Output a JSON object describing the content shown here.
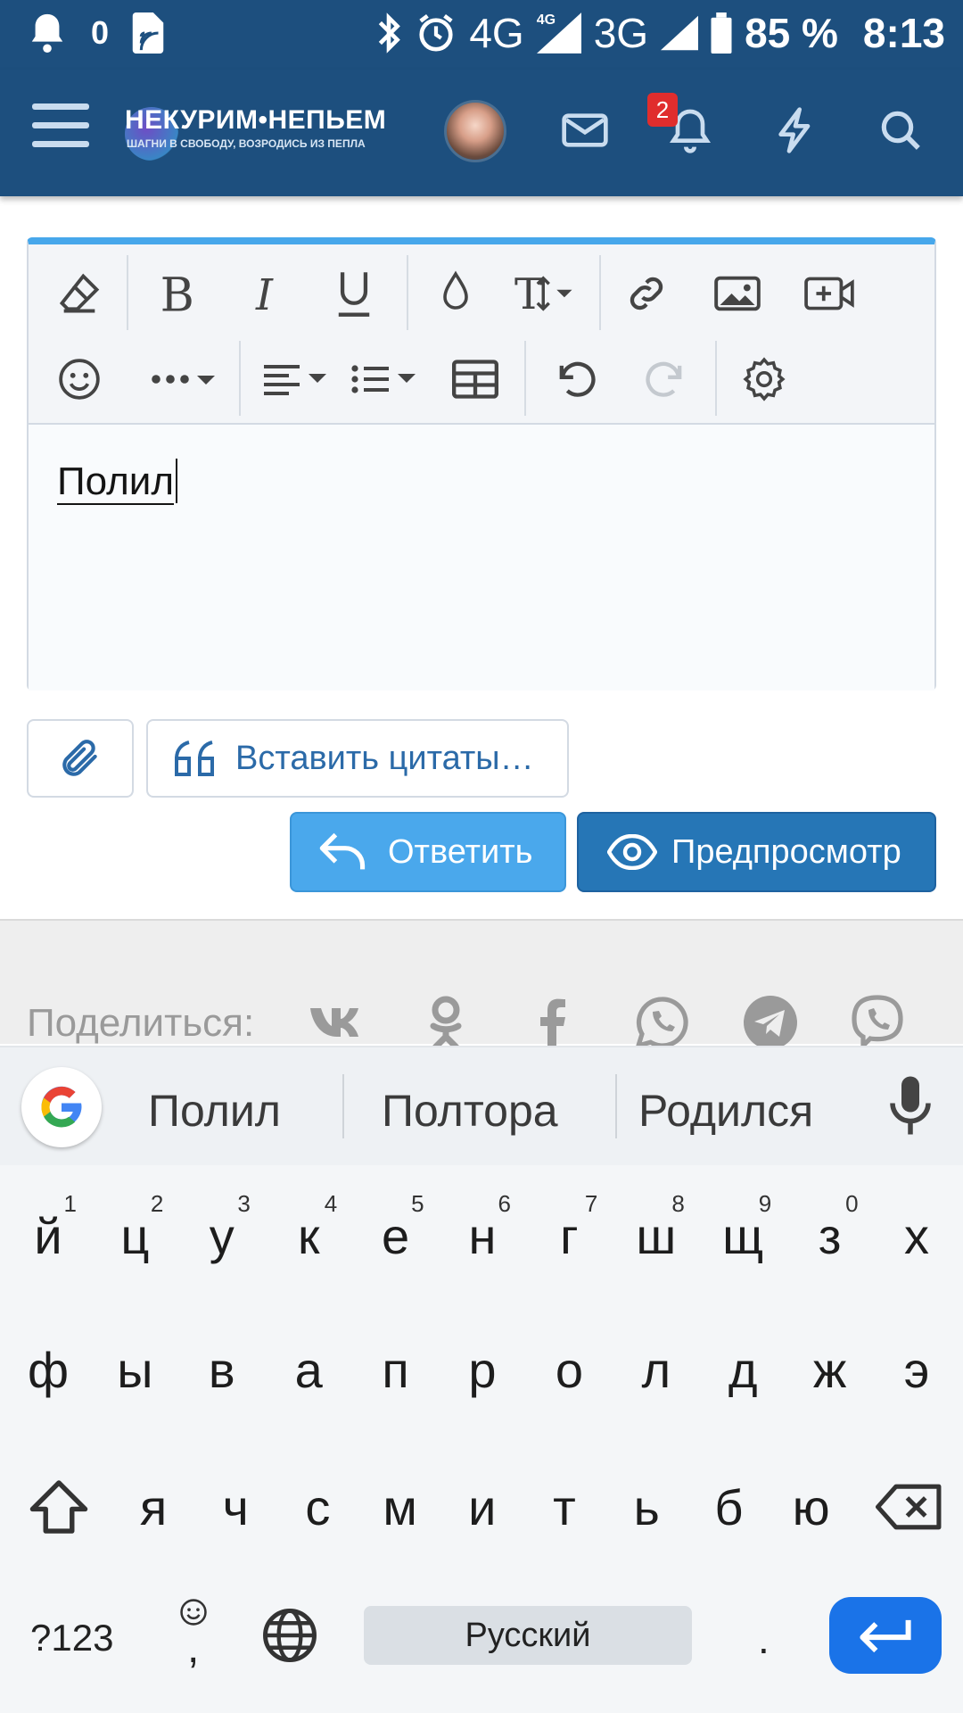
{
  "status": {
    "notif_count": "0",
    "network1": "4G",
    "network1_small": "4G",
    "network2": "3G",
    "battery": "85 %",
    "time": "8:13"
  },
  "header": {
    "logo_main": "НЕКУРИМ•НЕПЬЕМ",
    "logo_sub": "ШАГНИ В СВОБОДУ, ВОЗРОДИСЬ ИЗ ПЕПЛА",
    "alerts_badge": "2"
  },
  "editor": {
    "text": "Полил"
  },
  "actions": {
    "insert_quotes": "Вставить цитаты…",
    "reply": "Ответить",
    "preview": "Предпросмотр"
  },
  "share": {
    "label": "Поделиться:"
  },
  "keyboard": {
    "suggestions": [
      "Полил",
      "Полтора",
      "Родился"
    ],
    "row1": [
      {
        "k": "й",
        "h": "1"
      },
      {
        "k": "ц",
        "h": "2"
      },
      {
        "k": "у",
        "h": "3"
      },
      {
        "k": "к",
        "h": "4"
      },
      {
        "k": "е",
        "h": "5"
      },
      {
        "k": "н",
        "h": "6"
      },
      {
        "k": "г",
        "h": "7"
      },
      {
        "k": "ш",
        "h": "8"
      },
      {
        "k": "щ",
        "h": "9"
      },
      {
        "k": "з",
        "h": "0"
      },
      {
        "k": "х",
        "h": ""
      }
    ],
    "row2": [
      "ф",
      "ы",
      "в",
      "а",
      "п",
      "р",
      "о",
      "л",
      "д",
      "ж",
      "э"
    ],
    "row3": [
      "я",
      "ч",
      "с",
      "м",
      "и",
      "т",
      "ь",
      "б",
      "ю"
    ],
    "sym_key": "?123",
    "comma": ",",
    "space_label": "Русский",
    "period": "."
  },
  "colors": {
    "header_bg": "#1d4f7e",
    "accent": "#47a7eb",
    "reply_btn": "#4aa8ec",
    "preview_btn": "#2676b6",
    "enter_key": "#1a73e8",
    "badge": "#e02d2d"
  }
}
